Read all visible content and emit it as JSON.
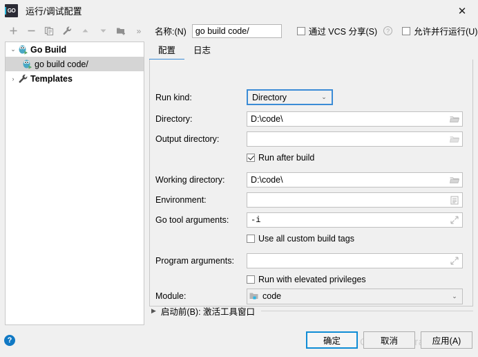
{
  "window": {
    "title": "运行/调试配置",
    "app_icon": "go-logo-icon",
    "close_label": "✕"
  },
  "toolbar": {
    "icons": [
      {
        "name": "add-icon",
        "glyph": "+"
      },
      {
        "name": "remove-icon",
        "glyph": "−"
      },
      {
        "name": "copy-icon",
        "glyph": "copy"
      },
      {
        "name": "edit-templates-icon",
        "glyph": "wrench"
      },
      {
        "name": "move-up-icon",
        "glyph": "▲"
      },
      {
        "name": "move-down-icon",
        "glyph": "▼"
      },
      {
        "name": "move-into-folder-icon",
        "glyph": "folder-plus"
      },
      {
        "name": "more-icon",
        "glyph": "»"
      }
    ],
    "name_label": "名称:(N)",
    "name_value": "go build code/",
    "share_vcs_label": "通过 VCS 分享(S)",
    "share_vcs_checked": false,
    "help_glyph": "?",
    "allow_parallel_label": "允许并行运行(U)",
    "allow_parallel_checked": false
  },
  "tree": {
    "items": [
      {
        "label": "Go Build",
        "icon": "go-run-icon",
        "twisty": "⌄",
        "level": 0,
        "bold": true,
        "selected": false
      },
      {
        "label": "go build code/",
        "icon": "go-run-icon",
        "twisty": "",
        "level": 1,
        "bold": false,
        "selected": true
      },
      {
        "label": "Templates",
        "icon": "wrench-icon",
        "twisty": "›",
        "level": 0,
        "bold": true,
        "selected": false
      }
    ]
  },
  "tabs": [
    {
      "label": "配置",
      "active": true
    },
    {
      "label": "日志",
      "active": false
    }
  ],
  "form": {
    "run_kind": {
      "label": "Run kind:",
      "value": "Directory",
      "arrow": "⌄"
    },
    "directory": {
      "label": "Directory:",
      "value": "D:\\code\\",
      "icon": "folder-browse-icon"
    },
    "output_directory": {
      "label": "Output directory:",
      "value": "",
      "icon": "folder-browse-icon"
    },
    "run_after_build": {
      "label": "Run after build",
      "checked": true
    },
    "working_directory": {
      "label": "Working directory:",
      "value": "D:\\code\\",
      "icon": "folder-browse-icon"
    },
    "environment": {
      "label": "Environment:",
      "value": "",
      "icon": "environment-list-icon"
    },
    "go_tool_arguments": {
      "label": "Go tool arguments:",
      "value": "-i",
      "icon": "expand-editor-icon"
    },
    "use_custom_build_tags": {
      "label": "Use all custom build tags",
      "checked": false
    },
    "program_arguments": {
      "label": "Program arguments:",
      "value": "",
      "icon": "expand-editor-icon"
    },
    "run_elevated": {
      "label": "Run with elevated privileges",
      "checked": false
    },
    "module": {
      "label": "Module:",
      "value": "code",
      "icon": "module-folder-icon",
      "arrow": "⌄"
    }
  },
  "before_launch": {
    "twisty": "▶",
    "label": "启动前(B): 激活工具窗口"
  },
  "footer": {
    "help_glyph": "?",
    "ok_label": "确定",
    "cancel_label": "取消",
    "apply_label": "应用(A)"
  },
  "watermark": "CSDN @Kirafenvy",
  "colors": {
    "accent": "#3a8bd6",
    "default_button_border": "#0f8cd5",
    "help_blue": "#1179c4",
    "selection_gray": "#d5d5d5"
  }
}
